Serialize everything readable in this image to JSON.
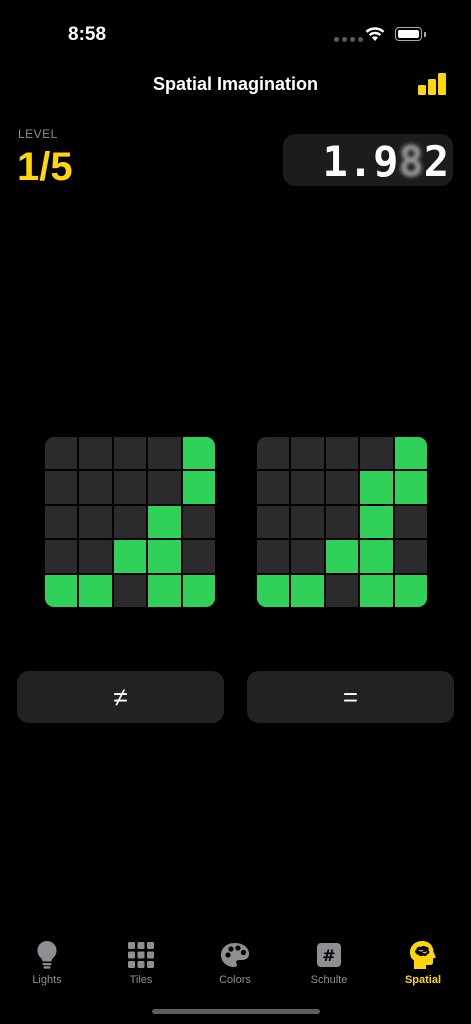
{
  "status_bar": {
    "time": "8:58"
  },
  "header": {
    "title": "Spatial Imagination"
  },
  "level": {
    "label": "LEVEL",
    "value": "1/5"
  },
  "timer": {
    "value_prefix": "1.9",
    "value_blurred": "8",
    "value_suffix": "2"
  },
  "grids": {
    "left": [
      [
        0,
        0,
        0,
        0,
        1
      ],
      [
        0,
        0,
        0,
        0,
        1
      ],
      [
        0,
        0,
        0,
        1,
        0
      ],
      [
        0,
        0,
        1,
        1,
        0
      ],
      [
        1,
        1,
        0,
        1,
        1
      ]
    ],
    "right": [
      [
        0,
        0,
        0,
        0,
        1
      ],
      [
        0,
        0,
        0,
        1,
        1
      ],
      [
        0,
        0,
        0,
        1,
        0
      ],
      [
        0,
        0,
        1,
        1,
        0
      ],
      [
        1,
        1,
        0,
        1,
        1
      ]
    ]
  },
  "buttons": {
    "not_equal": "≠",
    "equal": "="
  },
  "tabs": [
    {
      "label": "Lights",
      "icon": "lightbulb-icon"
    },
    {
      "label": "Tiles",
      "icon": "grid-icon"
    },
    {
      "label": "Colors",
      "icon": "palette-icon"
    },
    {
      "label": "Schulte",
      "icon": "hash-icon"
    },
    {
      "label": "Spatial",
      "icon": "brain-head-icon",
      "active": true
    }
  ],
  "colors": {
    "accent": "#ffd60a",
    "cell_on": "#30d158",
    "cell_off": "#2b2b2d"
  }
}
